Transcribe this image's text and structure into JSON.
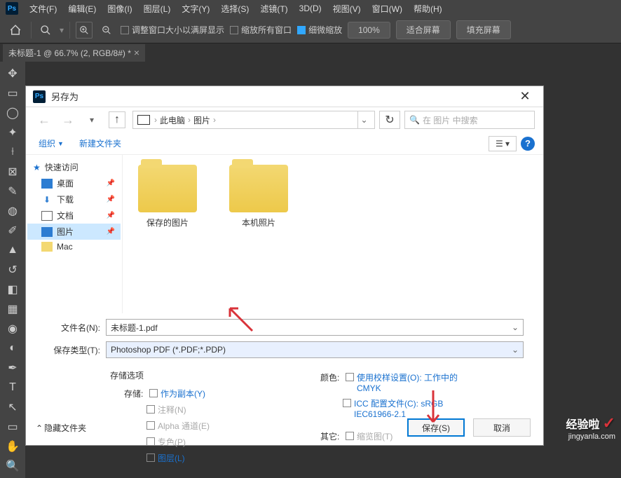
{
  "app": {
    "logo": "Ps"
  },
  "menu": [
    "文件(F)",
    "编辑(E)",
    "图像(I)",
    "图层(L)",
    "文字(Y)",
    "选择(S)",
    "滤镜(T)",
    "3D(D)",
    "视图(V)",
    "窗口(W)",
    "帮助(H)"
  ],
  "topToolbar": {
    "opt1": "调整窗口大小以满屏显示",
    "opt2": "缩放所有窗口",
    "opt3": "细微缩放",
    "zoom100": "100%",
    "fitScreen": "适合屏幕",
    "fillScreen": "填充屏幕"
  },
  "tab": {
    "title": "未标题-1 @ 66.7% (2, RGB/8#) *"
  },
  "dialog": {
    "title": "另存为",
    "breadcrumb": {
      "root": "此电脑",
      "folder": "图片"
    },
    "searchPlaceholder": "在 图片 中搜索",
    "organize": "组织",
    "newFolder": "新建文件夹",
    "sidebar": {
      "quickAccess": "快速访问",
      "desktop": "桌面",
      "downloads": "下载",
      "documents": "文档",
      "pictures": "图片",
      "mac": "Mac"
    },
    "files": {
      "saved": "保存的图片",
      "local": "本机照片"
    },
    "filenameLabel": "文件名(N):",
    "filenameValue": "未标题-1.pdf",
    "typeLabel": "保存类型(T):",
    "typeValue": "Photoshop PDF (*.PDF;*.PDP)",
    "storageOptions": "存储选项",
    "saveLabel": "存储:",
    "asCopy": "作为副本(Y)",
    "annotations": "注释(N)",
    "alpha": "Alpha 通道(E)",
    "spot": "专色(P)",
    "layers": "图层(L)",
    "colorLabel": "颜色:",
    "proofSetup": "使用校样设置(O):  工作中的 CMYK",
    "iccProfile": "ICC 配置文件(C): sRGB IEC61966-2.1",
    "otherLabel": "其它:",
    "thumbnail": "缩览图(T)",
    "hideFolders": "隐藏文件夹",
    "saveBtn": "保存(S)",
    "cancelBtn": "取消"
  },
  "watermark": {
    "text": "经验啦",
    "url": "jingyanla.com"
  }
}
